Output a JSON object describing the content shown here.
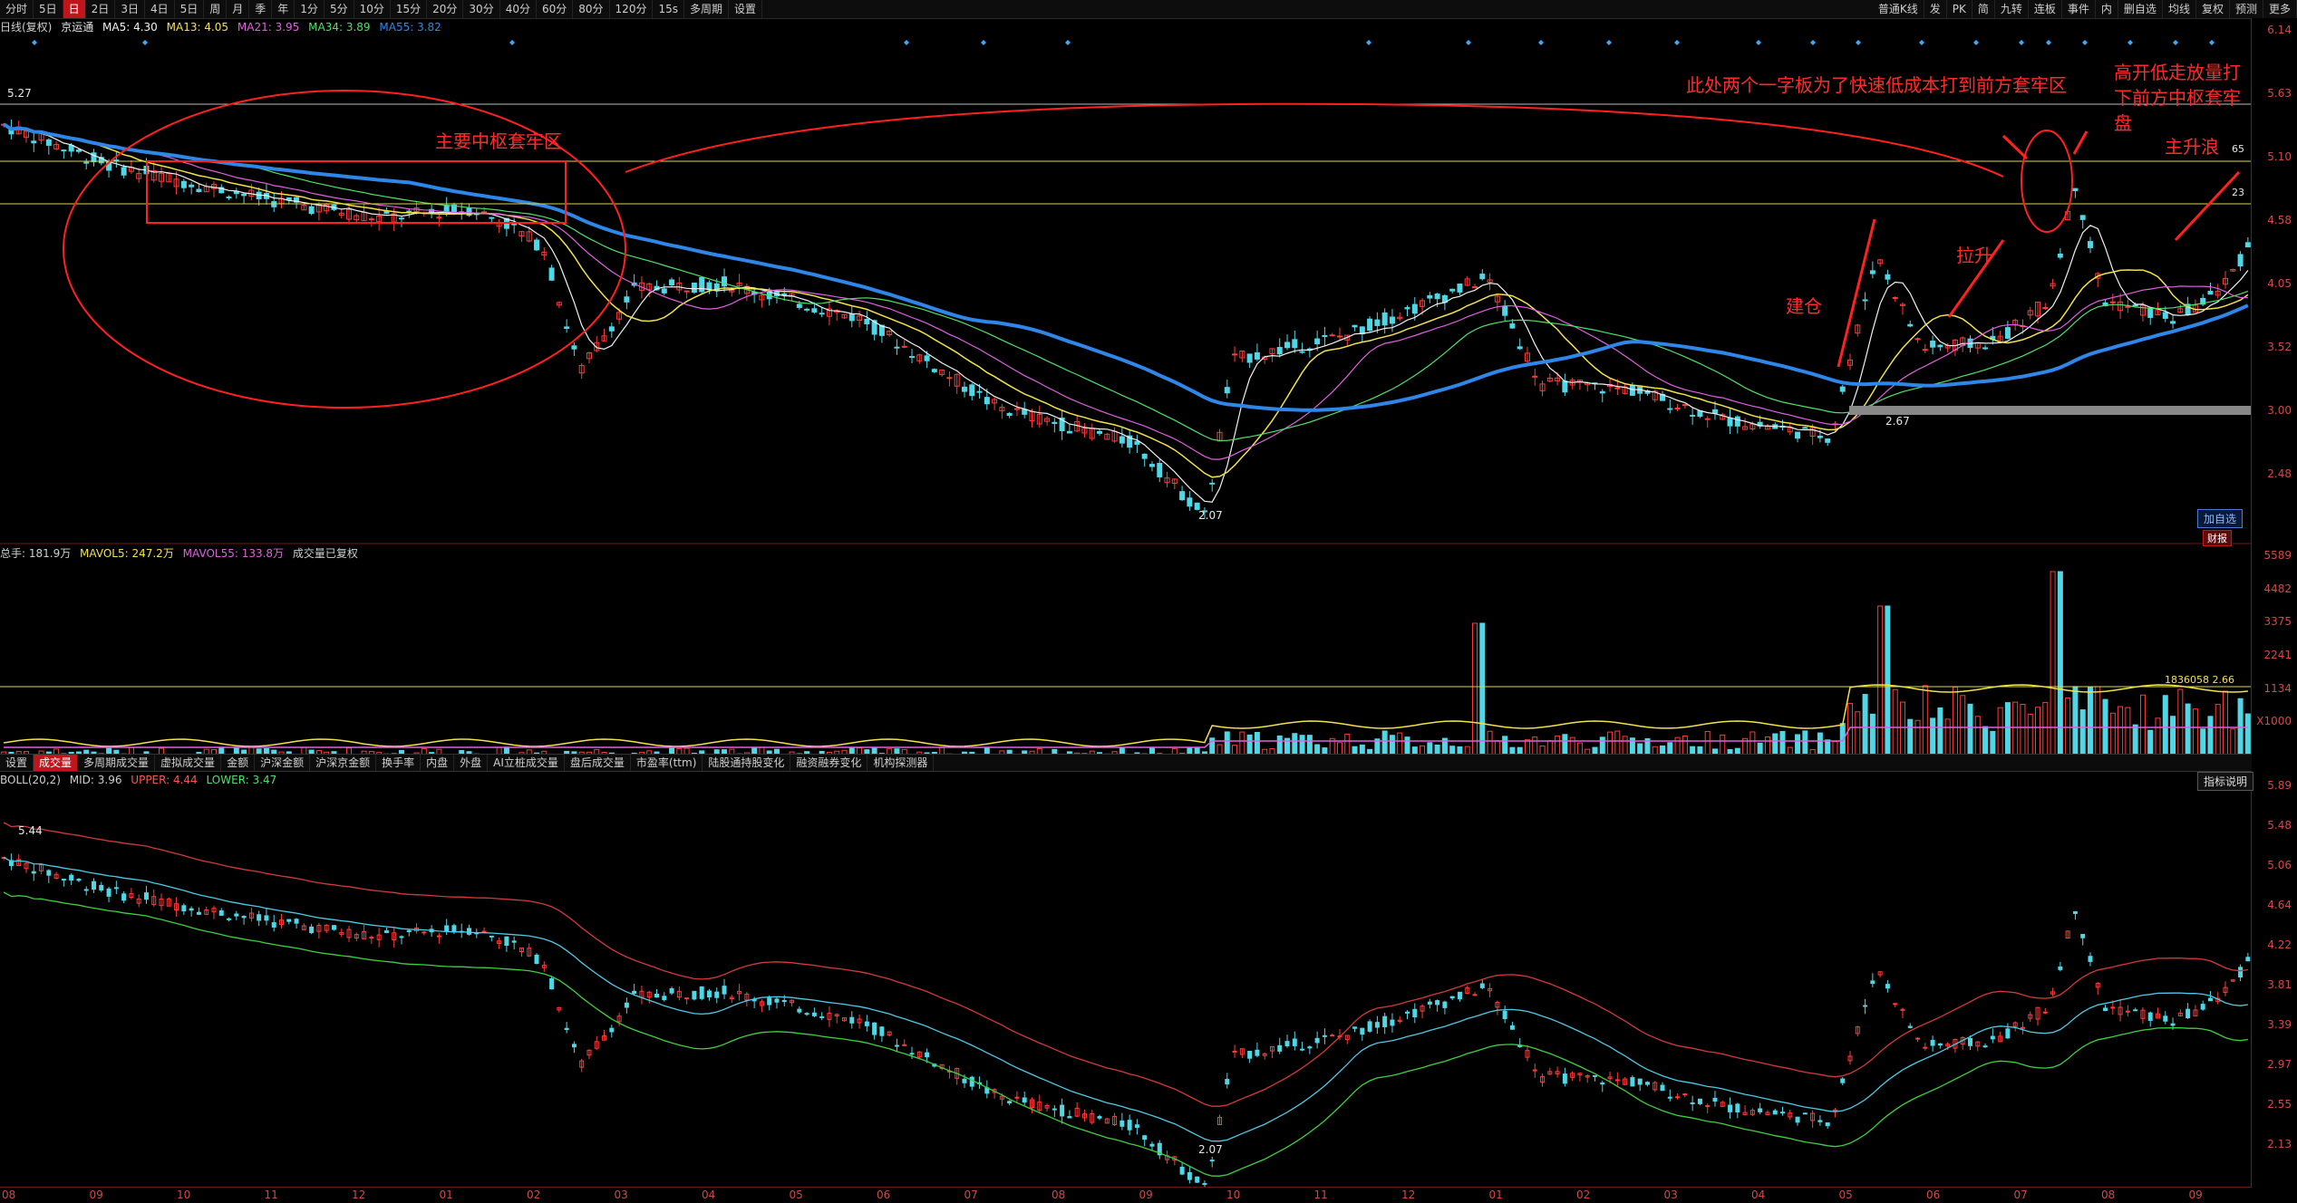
{
  "toolbar": {
    "periods": [
      "分时",
      "5日",
      "日",
      "2日",
      "3日",
      "4日",
      "5日",
      "周",
      "月",
      "季",
      "年",
      "1分",
      "5分",
      "10分",
      "15分",
      "20分",
      "30分",
      "40分",
      "60分",
      "80分",
      "120分",
      "15s",
      "多周期",
      "设置"
    ],
    "active_period": "日",
    "right_items": [
      "普通K线",
      "发",
      "PK",
      "简",
      "九转",
      "连板",
      "事件",
      "内",
      "删自选",
      "均线",
      "复权",
      "预测",
      "更多"
    ]
  },
  "price_legend": {
    "period_name": "日线(复权)",
    "stock_name": "京运通",
    "ma5": "MA5: 4.30",
    "ma13": "MA13: 4.05",
    "ma21": "MA21: 3.95",
    "ma34": "MA34: 3.89",
    "ma55": "MA55: 3.82"
  },
  "price_axis": [
    "6.14",
    "5.63",
    "5.10",
    "4.58",
    "4.05",
    "3.52",
    "3.00",
    "2.48"
  ],
  "price_labels": {
    "high_label": "5.27",
    "high_label2": "5.44",
    "low1": "2.07",
    "low2": "2.67",
    "r65": "65",
    "r23": "23"
  },
  "annotations": {
    "main_zone": "主要中枢套牢区",
    "two_boards": "此处两个一字板为了快速低成本打到前方套牢区",
    "gap_down": "高开低走放量打下前方中枢套牢盘",
    "build": "建仓",
    "pull": "拉升",
    "wave": "主升浪"
  },
  "buttons": {
    "add_watch": "加自选",
    "fin": "财报",
    "indicator_help": "指标说明"
  },
  "volume_legend": {
    "total": "总手: 181.9万",
    "mavol5": "MAVOL5: 247.2万",
    "mavol55": "MAVOL55: 133.8万",
    "note": "成交量已复权"
  },
  "volume_axis": [
    "5589",
    "4482",
    "3375",
    "2241",
    "1134",
    "X1000"
  ],
  "volume_marker": "1836058 2.66",
  "tabs": [
    "设置",
    "成交量",
    "多周期成交量",
    "虚拟成交量",
    "金额",
    "沪深金额",
    "沪深京金额",
    "换手率",
    "内盘",
    "外盘",
    "AI立桩成交量",
    "盘后成交量",
    "市盈率(ttm)",
    "陆股通持股变化",
    "融资融券变化",
    "机构探测器"
  ],
  "active_tab": "成交量",
  "boll_legend": {
    "name": "BOLL(20,2)",
    "mid": "MID: 3.96",
    "upper": "UPPER: 4.44",
    "lower": "LOWER: 3.47"
  },
  "boll_axis": [
    "5.89",
    "5.48",
    "5.06",
    "4.64",
    "4.22",
    "3.81",
    "3.39",
    "2.97",
    "2.55",
    "2.13"
  ],
  "boll_labels": {
    "top": "5.44",
    "low": "2.07"
  },
  "x_axis": [
    "08",
    "09",
    "10",
    "11",
    "12",
    "01",
    "02",
    "03",
    "04",
    "05",
    "06",
    "07",
    "08",
    "09",
    "10",
    "11",
    "12",
    "01",
    "02",
    "03",
    "04",
    "05",
    "06",
    "07",
    "08",
    "09"
  ],
  "colors": {
    "up": "#ff3b3b",
    "down": "#4fd7e6",
    "ma5": "#f2f2f2",
    "ma13": "#f2e24a",
    "ma21": "#e060e0",
    "ma34": "#4fe16b",
    "ma55": "#2e86e8",
    "annotation": "#ff2b2b"
  }
}
